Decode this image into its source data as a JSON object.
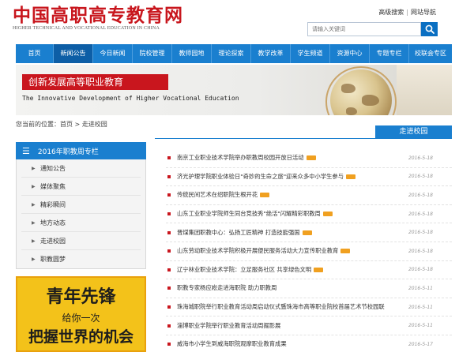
{
  "header": {
    "logo_cn": "中国高职高专教育网",
    "logo_en": "HIGHER TECHNICAL AND VOCATIONAL EDUCATION IN CHINA",
    "top_links": [
      "高级搜索",
      "网站导航"
    ],
    "search_placeholder": "请输入关键词",
    "search_icon": "search-icon"
  },
  "nav": {
    "items": [
      "首页",
      "新闻公告",
      "今日新闻",
      "院校管理",
      "教师园地",
      "理论探索",
      "教学改革",
      "学生频道",
      "资源中心",
      "专题专栏",
      "校联会专区"
    ],
    "active_index": 1
  },
  "banner": {
    "title": "创新发展高等职业教育",
    "subtitle": "The Innovative Development of Higher Vocational Education"
  },
  "breadcrumb": "您当前的位置：首页 > 走进校园",
  "section_title": "走进校园",
  "sidebar": {
    "title": "2016年职教周专栏",
    "items": [
      "通知公告",
      "媒体聚焦",
      "精彩瞬间",
      "地方动态",
      "走进校园",
      "职教圆梦"
    ]
  },
  "promo": {
    "line1": "青年先锋",
    "line2": "给你一次",
    "line3": "把握世界的机会"
  },
  "news": [
    {
      "title": "南京工业职业技术学院举办职教周校园开放日活动",
      "new": true,
      "date": "2016-5-18"
    },
    {
      "title": "济光护理学院职业体验日\"奇妙的生命之旅\"迎来众多中小学生参与",
      "new": true,
      "date": "2016-5-18"
    },
    {
      "title": "传统民间艺术在绍职院生根开花",
      "new": true,
      "date": "2016-5-18"
    },
    {
      "title": "山东工业职业学院师生同台竞技秀\"绝活\"闪耀精彩职教周",
      "new": true,
      "date": "2016-5-18"
    },
    {
      "title": "晋煤集团职教中心：弘扬工匠精神 打造技能强国",
      "new": true,
      "date": "2016-5-18"
    },
    {
      "title": "山东劳动职业技术学院积极开展便民服务活动大力宣传职业教育",
      "new": true,
      "date": "2016-5-18"
    },
    {
      "title": "辽宁林业职业技术学院：立足服务社区 共享绿色文明",
      "new": true,
      "date": "2016-5-18"
    },
    {
      "title": "职教专家杨应崧走进海职院 助力职教周",
      "new": false,
      "date": "2016-5-11"
    },
    {
      "title": "珠海城职院举行职业教育活动周启动仪式暨珠海市高等职业院校首届艺术节校园联",
      "new": false,
      "date": "2016-5-11"
    },
    {
      "title": "淄博职业学院举行职业教育活动周掘影展",
      "new": false,
      "date": "2016-5-11"
    },
    {
      "title": "威海市小学生到威海职院观摩职业教育成果",
      "new": false,
      "date": "2016-5-17"
    }
  ],
  "colors": {
    "brand_blue": "#1a7fcf",
    "brand_red": "#c8161d",
    "badge_orange": "#f0a020"
  }
}
